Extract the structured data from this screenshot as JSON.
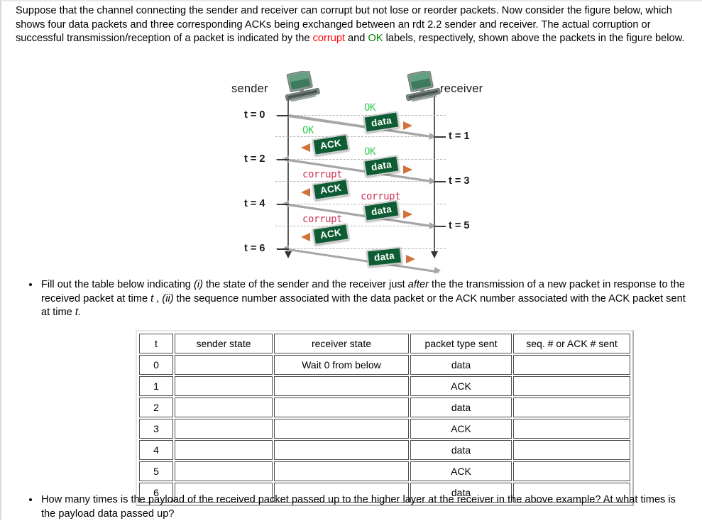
{
  "intro": {
    "part1": "Suppose that the channel connecting the sender and receiver can corrupt but not lose or reorder packets. Now consider the figure below, which shows four data packets and three corresponding ACKs being exchanged between an rdt 2.2 sender and receiver. The actual corruption or successful transmission/reception of a packet is indicated by the ",
    "corrupt_word": "corrupt",
    "part2": " and ",
    "ok_word": "OK",
    "part3": " labels, respectively, shown above the packets in the figure below."
  },
  "figure": {
    "sender_label": "sender",
    "receiver_label": "receiver",
    "left_time_labels": [
      "t = 0",
      "t = 2",
      "t = 4",
      "t = 6"
    ],
    "right_time_labels": [
      "t = 1",
      "t = 3",
      "t = 5"
    ],
    "packets": [
      {
        "id": "data-0",
        "label": "data",
        "status": "OK",
        "direction": "right"
      },
      {
        "id": "ack-1",
        "label": "ACK",
        "status": "OK",
        "direction": "left"
      },
      {
        "id": "data-2",
        "label": "data",
        "status": "OK",
        "direction": "right"
      },
      {
        "id": "ack-3",
        "label": "ACK",
        "status": "corrupt",
        "direction": "left"
      },
      {
        "id": "data-4",
        "label": "data",
        "status": "corrupt",
        "direction": "right"
      },
      {
        "id": "ack-5",
        "label": "ACK",
        "status": "corrupt",
        "direction": "left"
      },
      {
        "id": "data-6",
        "label": "data",
        "status": "",
        "direction": "right"
      }
    ],
    "colors": {
      "packet_fill": "#0d5c34",
      "packet_arrow": "#d4703a",
      "wire": "#a6a6a6",
      "ok_label": "#33cc55",
      "corrupt_label": "#cc3355"
    }
  },
  "bullets": {
    "first": {
      "seg1": "Fill out the table below indicating ",
      "em1": "(i)",
      "seg2": " the state of the sender and the receiver just ",
      "em2": "after",
      "seg3": " the the transmission of a new packet in response to the received packet at time ",
      "em3": "t",
      "seg4": " , ",
      "em4": "(ii)",
      "seg5": " the sequence number associated with the data packet or the ACK number associated with the ACK packet sent at time ",
      "em5": "t",
      "seg6": "."
    },
    "second": "How many times is the payload of the received packet passed up to the higher layer at the receiver in the above example? At what times is the payload data passed up?"
  },
  "table": {
    "headers": [
      "t",
      "sender state",
      "receiver state",
      "packet type sent",
      "seq. # or ACK # sent"
    ],
    "rows": [
      {
        "t": "0",
        "sender_state": "",
        "receiver_state": "Wait 0 from below",
        "packet_type": "data",
        "seq_ack": ""
      },
      {
        "t": "1",
        "sender_state": "",
        "receiver_state": "",
        "packet_type": "ACK",
        "seq_ack": ""
      },
      {
        "t": "2",
        "sender_state": "",
        "receiver_state": "",
        "packet_type": "data",
        "seq_ack": ""
      },
      {
        "t": "3",
        "sender_state": "",
        "receiver_state": "",
        "packet_type": "ACK",
        "seq_ack": ""
      },
      {
        "t": "4",
        "sender_state": "",
        "receiver_state": "",
        "packet_type": "data",
        "seq_ack": ""
      },
      {
        "t": "5",
        "sender_state": "",
        "receiver_state": "",
        "packet_type": "ACK",
        "seq_ack": ""
      },
      {
        "t": "6",
        "sender_state": "",
        "receiver_state": "",
        "packet_type": "data",
        "seq_ack": ""
      }
    ]
  }
}
